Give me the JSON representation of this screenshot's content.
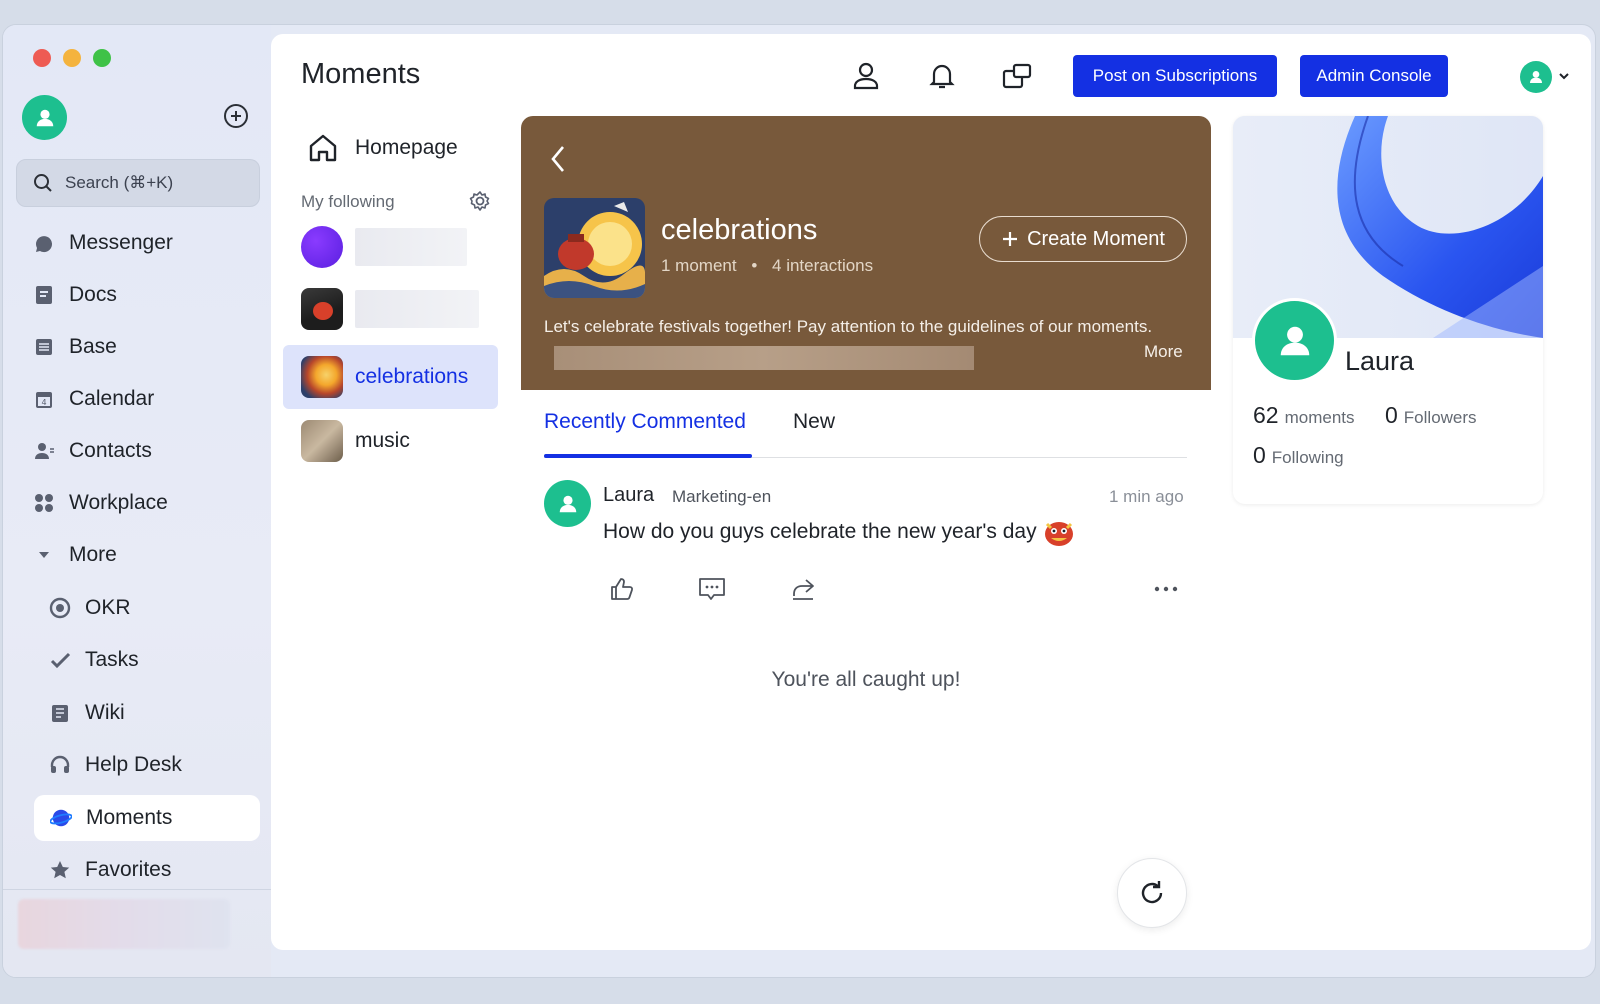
{
  "sidebar": {
    "search_placeholder": "Search (⌘+K)",
    "items": [
      {
        "label": "Messenger",
        "icon": "messenger-icon"
      },
      {
        "label": "Docs",
        "icon": "docs-icon"
      },
      {
        "label": "Base",
        "icon": "base-icon"
      },
      {
        "label": "Calendar",
        "icon": "calendar-icon"
      },
      {
        "label": "Contacts",
        "icon": "contacts-icon"
      },
      {
        "label": "Workplace",
        "icon": "workplace-icon"
      },
      {
        "label": "More",
        "icon": "caret-down-icon"
      }
    ],
    "more_items": [
      {
        "label": "OKR",
        "icon": "okr-icon"
      },
      {
        "label": "Tasks",
        "icon": "tasks-icon"
      },
      {
        "label": "Wiki",
        "icon": "wiki-icon"
      },
      {
        "label": "Help Desk",
        "icon": "help-desk-icon"
      },
      {
        "label": "Moments",
        "icon": "moments-icon",
        "active": true
      },
      {
        "label": "Favorites",
        "icon": "star-icon"
      }
    ]
  },
  "header": {
    "title": "Moments",
    "post_button": "Post on Subscriptions",
    "admin_button": "Admin Console"
  },
  "following": {
    "homepage": "Homepage",
    "label": "My following",
    "channels": [
      "celebrations",
      "music"
    ]
  },
  "channel": {
    "title": "celebrations",
    "moments": "1 moment",
    "interactions": "4 interactions",
    "separator": "•",
    "create_button": "Create Moment",
    "description": "Let's celebrate festivals together! Pay attention to the guidelines of our moments.",
    "more": "More"
  },
  "tabs": {
    "recent": "Recently Commented",
    "new": "New"
  },
  "post": {
    "author": "Laura",
    "department": "Marketing-en",
    "time": "1 min ago",
    "text": "How do you guys celebrate the new year's day"
  },
  "feed_end": "You're all caught up!",
  "profile": {
    "name": "Laura",
    "moments_count": "62",
    "moments_label": "moments",
    "followers_count": "0",
    "followers_label": "Followers",
    "following_count": "0",
    "following_label": "Following"
  },
  "colors": {
    "accent": "#1430e3",
    "avatar": "#1dbf8f",
    "banner": "#78593b"
  }
}
